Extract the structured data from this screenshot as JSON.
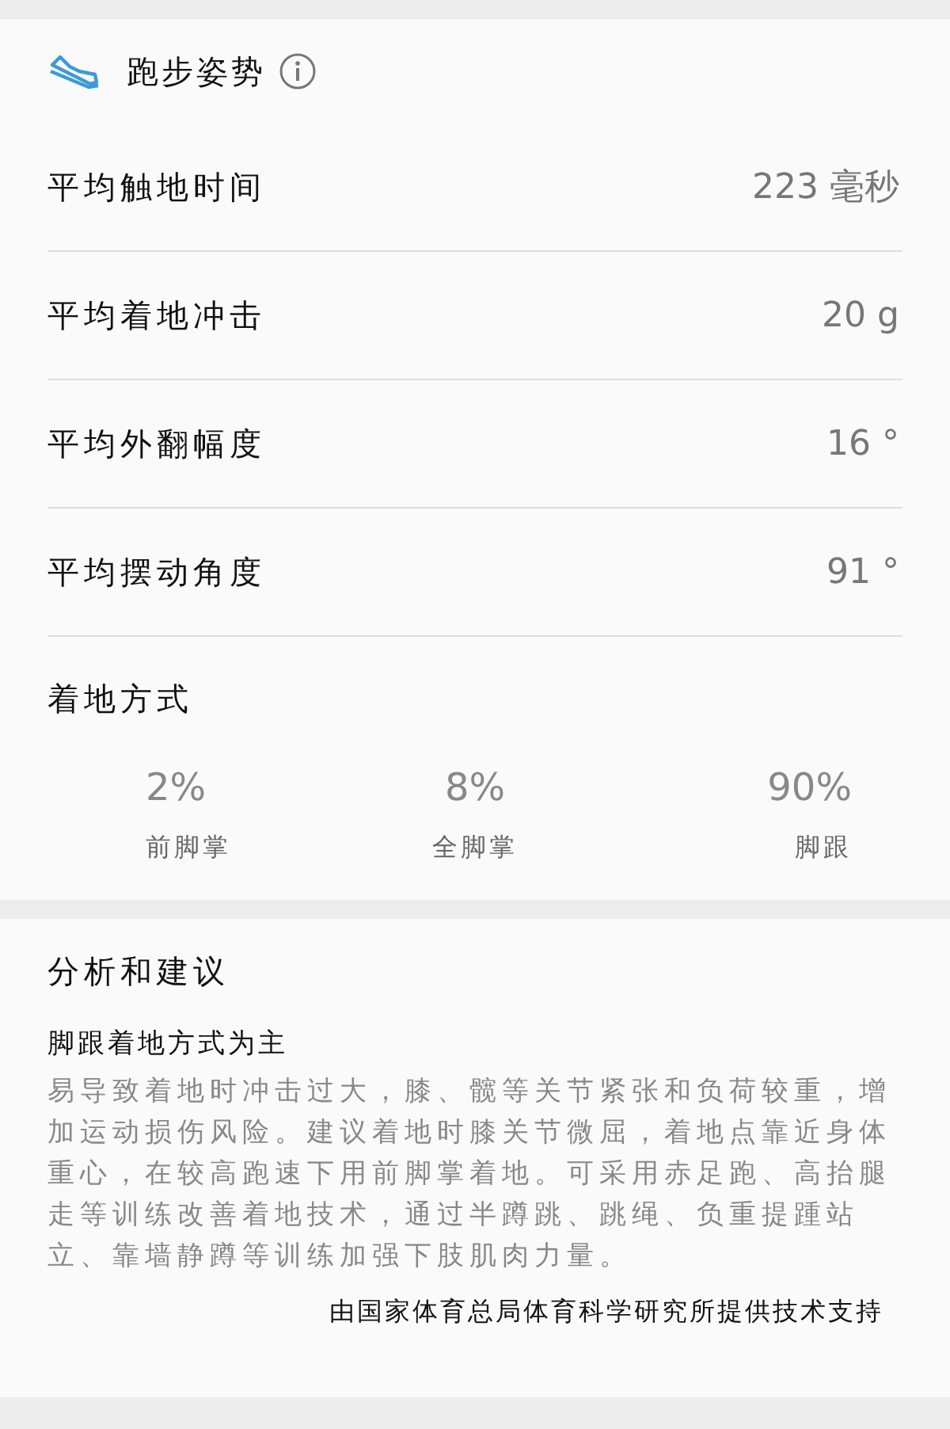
{
  "header": {
    "title": "跑步姿势"
  },
  "metrics": [
    {
      "label": "平均触地时间",
      "value": "223 毫秒"
    },
    {
      "label": "平均着地冲击",
      "value": "20 g"
    },
    {
      "label": "平均外翻幅度",
      "value": "16 °"
    },
    {
      "label": "平均摆动角度",
      "value": "91 °"
    }
  ],
  "strike": {
    "title": "着地方式",
    "items": [
      {
        "value": "2%",
        "label": "前脚掌"
      },
      {
        "value": "8%",
        "label": "全脚掌"
      },
      {
        "value": "90%",
        "label": "脚跟"
      }
    ]
  },
  "analysis": {
    "title": "分析和建议",
    "subtitle": "脚跟着地方式为主",
    "text": "易导致着地时冲击过大，膝、髋等关节紧张和负荷较重，增加运动损伤风险。建议着地时膝关节微屈，着地点靠近身体重心，在较高跑速下用前脚掌着地。可采用赤足跑、高抬腿走等训练改善着地技术，通过半蹲跳、跳绳、负重提踵站立、靠墙静蹲等训练加强下肢肌肉力量。",
    "credit": "由国家体育总局体育科学研究所提供技术支持"
  }
}
